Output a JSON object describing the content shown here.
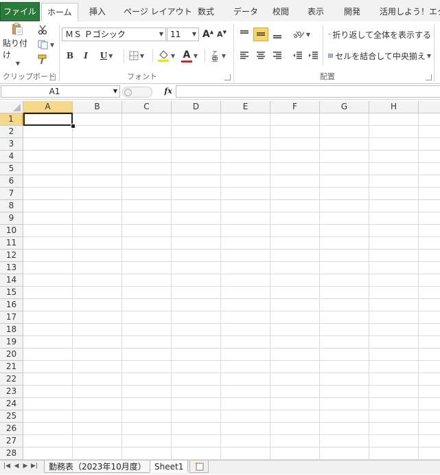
{
  "tabs": {
    "file": "ファイル",
    "home": "ホーム",
    "insert": "挿入",
    "page_layout": "ページ レイアウト",
    "formulas": "数式",
    "data": "データ",
    "review": "校閲",
    "view": "表示",
    "developer": "開発",
    "addin": "活用しよう！エクセ"
  },
  "ribbon": {
    "paste_label": "貼り付け",
    "clipboard_label": "クリップボード",
    "font_label": "フォント",
    "alignment_label": "配置",
    "font_name": "ＭＳ Ｐゴシック",
    "font_size": "11",
    "bold": "B",
    "italic": "I",
    "underline": "U",
    "font_color_letter": "A",
    "wrap_text": "折り返して全体を表示する",
    "merge_center": "セルを結合して中央揃え",
    "accent_font_color": "#e02020",
    "accent_fill_color": "#f5e300"
  },
  "formula_bar": {
    "name_box": "A1",
    "fx": "fx",
    "value": ""
  },
  "grid": {
    "columns": [
      "A",
      "B",
      "C",
      "D",
      "E",
      "F",
      "G",
      "H"
    ],
    "rows": [
      "1",
      "2",
      "3",
      "4",
      "5",
      "6",
      "7",
      "8",
      "9",
      "10",
      "11",
      "12",
      "13",
      "14",
      "15",
      "16",
      "17",
      "18",
      "19",
      "20",
      "21",
      "22",
      "23",
      "24",
      "25",
      "26",
      "27",
      "28"
    ],
    "selected_cell": "A1"
  },
  "sheets": {
    "tab1": "勤務表（2023年10月度）",
    "tab2": "Sheet1"
  }
}
